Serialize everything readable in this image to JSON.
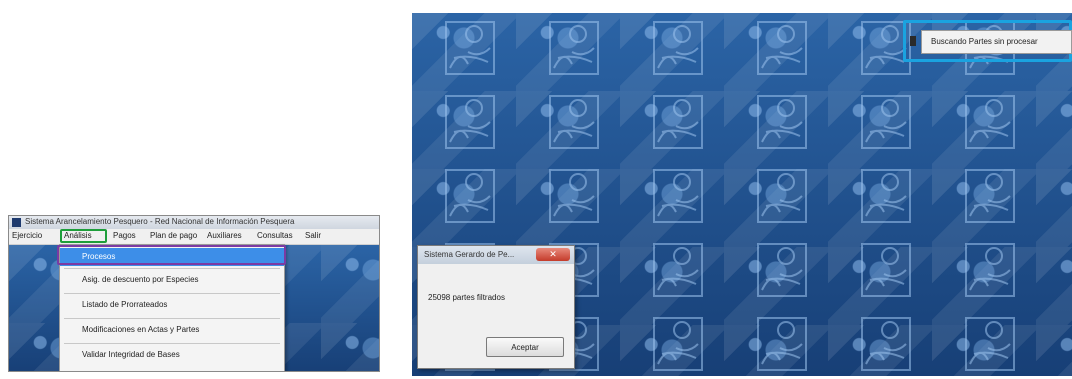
{
  "left": {
    "window_title": "Sistema Arancelamiento Pesquero - Red Nacional de Información Pesquera",
    "menu": [
      "Ejercicio",
      "Análisis",
      "Pagos",
      "Plan de pago",
      "Auxiliares",
      "Consultas",
      "Salir"
    ],
    "dropdown": [
      "Procesos",
      "Asig. de descuento por Especies",
      "Listado de Prorrateados",
      "Modificaciones en Actas y Partes",
      "Validar Integridad de Bases"
    ],
    "highlight_colors": {
      "menu": "#1e9e3a",
      "item": "#7b3aa3"
    }
  },
  "right": {
    "status_text": "Buscando Partes sin procesar",
    "callout_color": "#1aa3e0",
    "dialog": {
      "title": "Sistema Gerardo de Pe...",
      "message": "25098 partes filtrados",
      "button": "Aceptar"
    }
  }
}
